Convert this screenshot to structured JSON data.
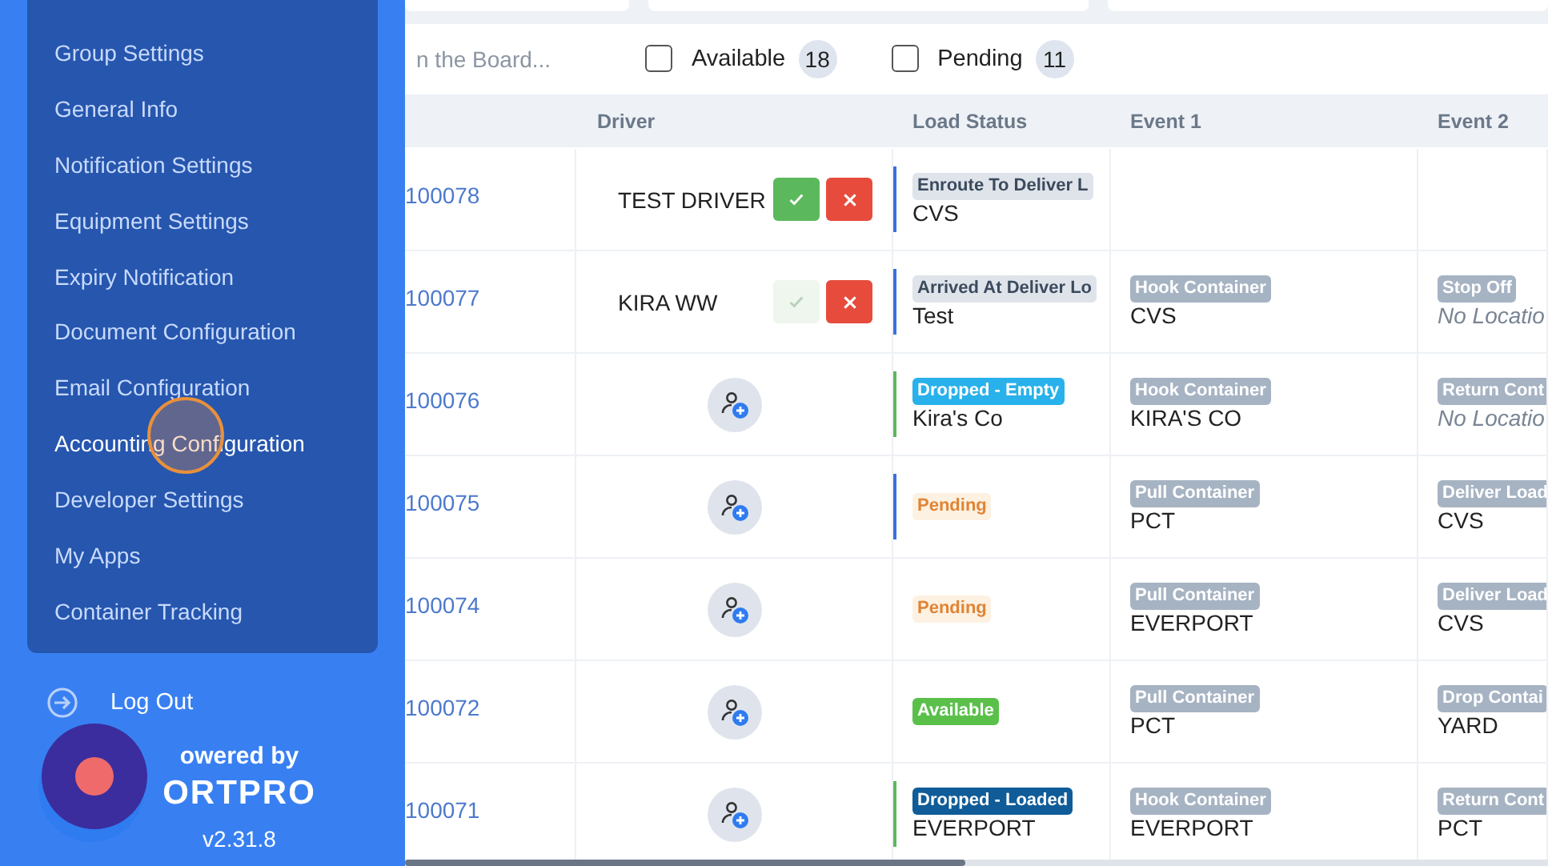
{
  "sidebar": {
    "items": [
      {
        "label": "Group Settings",
        "selected": false
      },
      {
        "label": "General Info",
        "selected": false
      },
      {
        "label": "Notification Settings",
        "selected": false
      },
      {
        "label": "Equipment Settings",
        "selected": false
      },
      {
        "label": "Expiry Notification",
        "selected": false
      },
      {
        "label": "Document Configuration",
        "selected": false
      },
      {
        "label": "Email Configuration",
        "selected": false
      },
      {
        "label": "Accounting Configuration",
        "selected": true
      },
      {
        "label": "Developer Settings",
        "selected": false
      },
      {
        "label": "My Apps",
        "selected": false
      },
      {
        "label": "Container Tracking",
        "selected": false
      }
    ],
    "logout": "Log Out",
    "powered_by": "owered by",
    "logo": "ORTPRO",
    "version": "v2.31.8"
  },
  "search": {
    "placeholder": "n the Board..."
  },
  "filters": [
    {
      "label": "Available",
      "count": "18",
      "checked": false
    },
    {
      "label": "Pending",
      "count": "11",
      "checked": false
    }
  ],
  "table": {
    "columns": [
      "Driver",
      "Load Status",
      "Event 1",
      "Event 2"
    ],
    "rows": [
      {
        "load": "100078",
        "driver": {
          "kind": "assigned",
          "name": "TEST DRIVER",
          "accept_disabled": false
        },
        "status": {
          "kind": "grey",
          "label": "Enroute To Deliver L",
          "location": "CVS"
        },
        "color": "#3b6fe0",
        "event_1": null,
        "event_2": null
      },
      {
        "load": "100077",
        "driver": {
          "kind": "assigned",
          "name": "KIRA WW",
          "accept_disabled": true
        },
        "status": {
          "kind": "grey",
          "label": "Arrived At Deliver Lo",
          "location": "Test"
        },
        "color": "#3b6fe0",
        "event_1": {
          "label": "Hook Container",
          "location": "CVS",
          "missing": false
        },
        "event_2": {
          "label": "Stop Off",
          "location": "No Locatio",
          "missing": true
        }
      },
      {
        "load": "100076",
        "driver": {
          "kind": "unassigned"
        },
        "status": {
          "kind": "light-blue",
          "label": "Dropped  - Empty",
          "location": "Kira's Co"
        },
        "color": "#5cb85c",
        "event_1": {
          "label": "Hook Container",
          "location": "KIRA'S CO",
          "missing": false
        },
        "event_2": {
          "label": "Return Cont",
          "location": "No Locatio",
          "missing": true
        }
      },
      {
        "load": "100075",
        "driver": {
          "kind": "unassigned"
        },
        "status": {
          "kind": "pending",
          "label": "Pending"
        },
        "color": "#3b6fe0",
        "event_1": {
          "label": "Pull Container",
          "location": "PCT",
          "missing": false
        },
        "event_2": {
          "label": "Deliver Load",
          "location": "CVS",
          "missing": false
        }
      },
      {
        "load": "100074",
        "driver": {
          "kind": "unassigned"
        },
        "status": {
          "kind": "pending",
          "label": "Pending"
        },
        "event_1": {
          "label": "Pull Container",
          "location": "EVERPORT",
          "missing": false
        },
        "event_2": {
          "label": "Deliver Load",
          "location": "CVS",
          "missing": false
        }
      },
      {
        "load": "100072",
        "driver": {
          "kind": "unassigned"
        },
        "status": {
          "kind": "green",
          "label": "Available"
        },
        "event_1": {
          "label": "Pull Container",
          "location": "PCT",
          "missing": false
        },
        "event_2": {
          "label": "Drop Contai",
          "location": "YARD",
          "missing": false
        }
      },
      {
        "load": "100071",
        "driver": {
          "kind": "unassigned"
        },
        "status": {
          "kind": "dark-blue",
          "label": "Dropped  - Loaded",
          "location": "EVERPORT"
        },
        "color": "#5cb85c",
        "event_1": {
          "label": "Hook Container",
          "location": "EVERPORT",
          "missing": false
        },
        "event_2": {
          "label": "Return Cont",
          "location": "PCT",
          "missing": false
        }
      }
    ]
  }
}
